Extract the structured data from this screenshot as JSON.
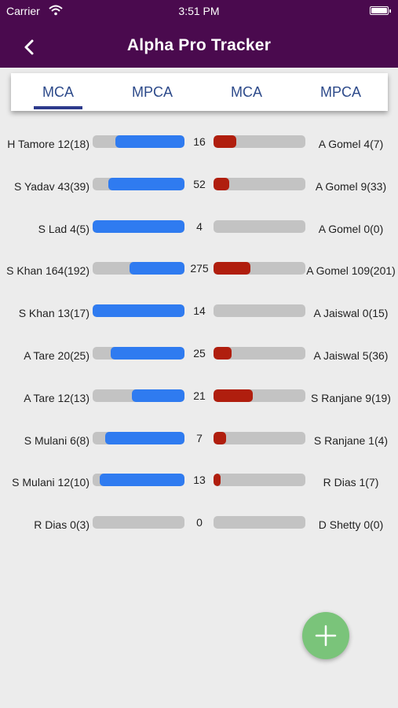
{
  "status_bar": {
    "carrier": "Carrier",
    "time": "3:51 PM"
  },
  "header": {
    "title": "Alpha Pro Tracker"
  },
  "tabs": [
    {
      "label": "MCA",
      "selected": true
    },
    {
      "label": "MPCA",
      "selected": false
    },
    {
      "label": "MCA",
      "selected": false
    },
    {
      "label": "MPCA",
      "selected": false
    }
  ],
  "colors": {
    "header": "#4a0a4e",
    "left_bar": "#2f7bf0",
    "right_bar": "#b01e0e",
    "bar_track": "#c3c3c3",
    "fab": "#7ac47a"
  },
  "rows": [
    {
      "left_name": "H Tamore 12(18)",
      "center_value": "16",
      "right_name": "A Gomel 4(7)",
      "left_fill": 0.75,
      "right_fill": 0.25
    },
    {
      "left_name": "S Yadav 43(39)",
      "center_value": "52",
      "right_name": "A Gomel 9(33)",
      "left_fill": 0.83,
      "right_fill": 0.17
    },
    {
      "left_name": "S Lad 4(5)",
      "center_value": "4",
      "right_name": "A Gomel 0(0)",
      "left_fill": 1.0,
      "right_fill": 0.0
    },
    {
      "left_name": "S Khan 164(192)",
      "center_value": "275",
      "right_name": "A Gomel 109(201)",
      "left_fill": 0.6,
      "right_fill": 0.4
    },
    {
      "left_name": "S Khan 13(17)",
      "center_value": "14",
      "right_name": "A Jaiswal 0(15)",
      "left_fill": 1.0,
      "right_fill": 0.0
    },
    {
      "left_name": "A Tare 20(25)",
      "center_value": "25",
      "right_name": "A Jaiswal 5(36)",
      "left_fill": 0.8,
      "right_fill": 0.2
    },
    {
      "left_name": "A Tare 12(13)",
      "center_value": "21",
      "right_name": "S Ranjane 9(19)",
      "left_fill": 0.57,
      "right_fill": 0.43
    },
    {
      "left_name": "S Mulani 6(8)",
      "center_value": "7",
      "right_name": "S Ranjane 1(4)",
      "left_fill": 0.86,
      "right_fill": 0.14
    },
    {
      "left_name": "S Mulani 12(10)",
      "center_value": "13",
      "right_name": "R Dias 1(7)",
      "left_fill": 0.92,
      "right_fill": 0.08
    },
    {
      "left_name": "R Dias 0(3)",
      "center_value": "0",
      "right_name": "D Shetty 0(0)",
      "left_fill": 0.0,
      "right_fill": 0.0
    }
  ],
  "fab": {
    "icon": "plus-icon"
  }
}
